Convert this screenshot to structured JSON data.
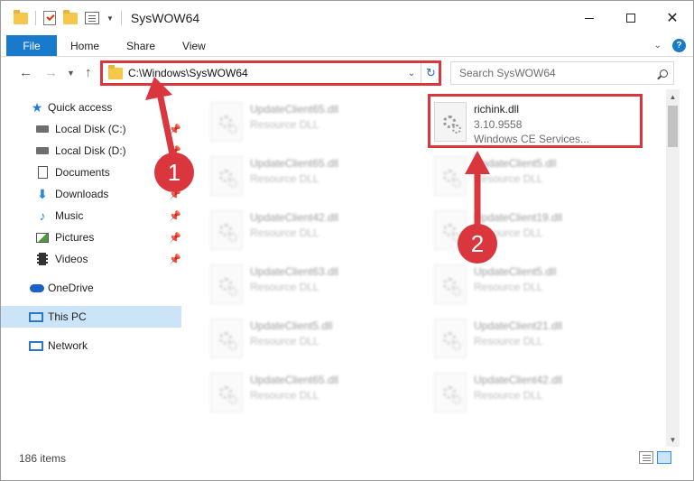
{
  "window": {
    "title": "SysWOW64",
    "colors": {
      "accent": "#1979ca",
      "annotation": "#d9363e",
      "selection": "#cce4f7"
    }
  },
  "ribbon": {
    "file_tab": "File",
    "tabs": [
      "Home",
      "Share",
      "View"
    ]
  },
  "navigation": {
    "address": "C:\\Windows\\SysWOW64",
    "search_placeholder": "Search SysWOW64"
  },
  "sidebar": {
    "items": [
      {
        "label": "Quick access",
        "icon": "star-icon"
      },
      {
        "label": "Local Disk (C:)",
        "icon": "drive-icon"
      },
      {
        "label": "Local Disk (D:)",
        "icon": "drive-icon"
      },
      {
        "label": "Documents",
        "icon": "documents-icon"
      },
      {
        "label": "Downloads",
        "icon": "downloads-icon"
      },
      {
        "label": "Music",
        "icon": "music-icon"
      },
      {
        "label": "Pictures",
        "icon": "pictures-icon"
      },
      {
        "label": "Videos",
        "icon": "videos-icon"
      },
      {
        "label": "OneDrive",
        "icon": "onedrive-icon"
      },
      {
        "label": "This PC",
        "icon": "this-pc-icon"
      },
      {
        "label": "Network",
        "icon": "network-icon"
      }
    ]
  },
  "files": {
    "highlighted": {
      "name": "richink.dll",
      "version": "3.10.9558",
      "description": "Windows CE Services..."
    },
    "left_column": [
      {
        "name": "UpdateClient65.dll",
        "type": "Resource DLL"
      },
      {
        "name": "UpdateClient65.dll",
        "type": "Resource DLL"
      },
      {
        "name": "UpdateClient42.dll",
        "type": "Resource DLL"
      },
      {
        "name": "UpdateClient63.dll",
        "type": "Resource DLL"
      },
      {
        "name": "UpdateClient5.dll",
        "type": "Resource DLL"
      },
      {
        "name": "UpdateClient65.dll",
        "type": "Resource DLL"
      }
    ],
    "right_column": [
      {
        "name": "UpdateClient5.dll",
        "type": "Resource DLL"
      },
      {
        "name": "UpdateClient19.dll",
        "type": "Resource DLL"
      },
      {
        "name": "UpdateClient5.dll",
        "type": "Resource DLL"
      },
      {
        "name": "UpdateClient21.dll",
        "type": "Resource DLL"
      },
      {
        "name": "UpdateClient42.dll",
        "type": "Resource DLL"
      }
    ]
  },
  "annotations": {
    "badge_1": "1",
    "badge_2": "2"
  },
  "status": {
    "item_count": "186 items"
  }
}
